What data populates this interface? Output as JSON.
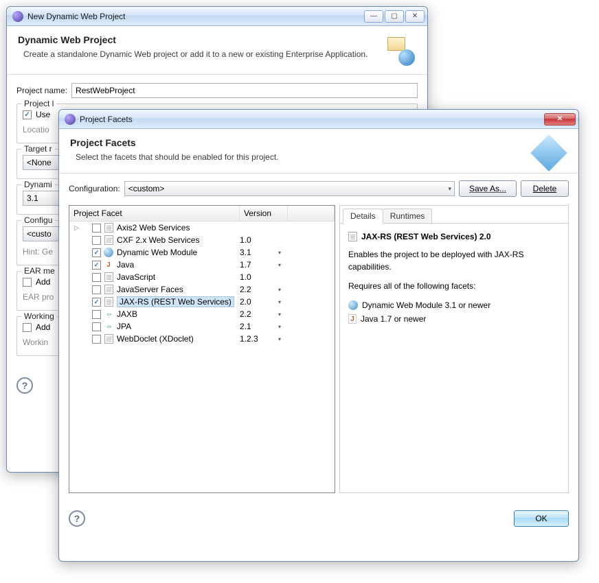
{
  "parent": {
    "title": "New Dynamic Web Project",
    "heading": "Dynamic Web Project",
    "subtitle": "Create a standalone Dynamic Web project or add it to a new or existing Enterprise Application.",
    "projectNameLabel": "Project name:",
    "projectName": "RestWebProject",
    "projectLocationLabel": "Project l",
    "useDefault": "Use",
    "locationLabel": "Locatio",
    "targetRuntimeLabel": "Target r",
    "targetRuntime": "<None",
    "dynamicLabel": "Dynami",
    "dynamic": "3.1",
    "configLabel": "Configu",
    "config": "<custo",
    "hint": "Hint: Ge",
    "earLabel": "EAR me",
    "addEar": "Add",
    "earProj": "EAR pro",
    "workingLabel": "Working",
    "addWorking": "Add",
    "workingHint": "Workin"
  },
  "facets": {
    "title": "Project Facets",
    "heading": "Project Facets",
    "subtitle": "Select the facets that should be enabled for this project.",
    "configLabel": "Configuration:",
    "configValue": "<custom>",
    "saveAs": "Save As...",
    "delete": "Delete",
    "columns": {
      "name": "Project Facet",
      "version": "Version"
    },
    "rows": [
      {
        "expand": true,
        "checked": false,
        "icon": "doc",
        "name": "Axis2 Web Services",
        "version": "",
        "dropdown": false
      },
      {
        "expand": false,
        "checked": false,
        "icon": "doc",
        "name": "CXF 2.x Web Services",
        "version": "1.0",
        "dropdown": false
      },
      {
        "expand": false,
        "checked": true,
        "icon": "globe",
        "name": "Dynamic Web Module",
        "version": "3.1",
        "dropdown": true
      },
      {
        "expand": false,
        "checked": true,
        "icon": "java",
        "name": "Java",
        "version": "1.7",
        "dropdown": true
      },
      {
        "expand": false,
        "checked": false,
        "icon": "doc",
        "name": "JavaScript",
        "version": "1.0",
        "dropdown": false
      },
      {
        "expand": false,
        "checked": false,
        "icon": "doc",
        "name": "JavaServer Faces",
        "version": "2.2",
        "dropdown": true
      },
      {
        "expand": false,
        "checked": true,
        "icon": "doc",
        "name": "JAX-RS (REST Web Services)",
        "version": "2.0",
        "dropdown": true,
        "selected": true
      },
      {
        "expand": false,
        "checked": false,
        "icon": "arrows",
        "name": "JAXB",
        "version": "2.2",
        "dropdown": true
      },
      {
        "expand": false,
        "checked": false,
        "icon": "arrows",
        "name": "JPA",
        "version": "2.1",
        "dropdown": true
      },
      {
        "expand": false,
        "checked": false,
        "icon": "doc",
        "name": "WebDoclet (XDoclet)",
        "version": "1.2.3",
        "dropdown": true
      }
    ],
    "tabs": {
      "details": "Details",
      "runtimes": "Runtimes"
    },
    "details": {
      "title": "JAX-RS (REST Web Services) 2.0",
      "desc": "Enables the project to be deployed with JAX-RS capabilities.",
      "reqHeading": "Requires all of the following facets:",
      "reqs": [
        {
          "icon": "globe",
          "text": "Dynamic Web Module 3.1 or newer"
        },
        {
          "icon": "java",
          "text": "Java 1.7 or newer"
        }
      ]
    },
    "ok": "OK"
  }
}
